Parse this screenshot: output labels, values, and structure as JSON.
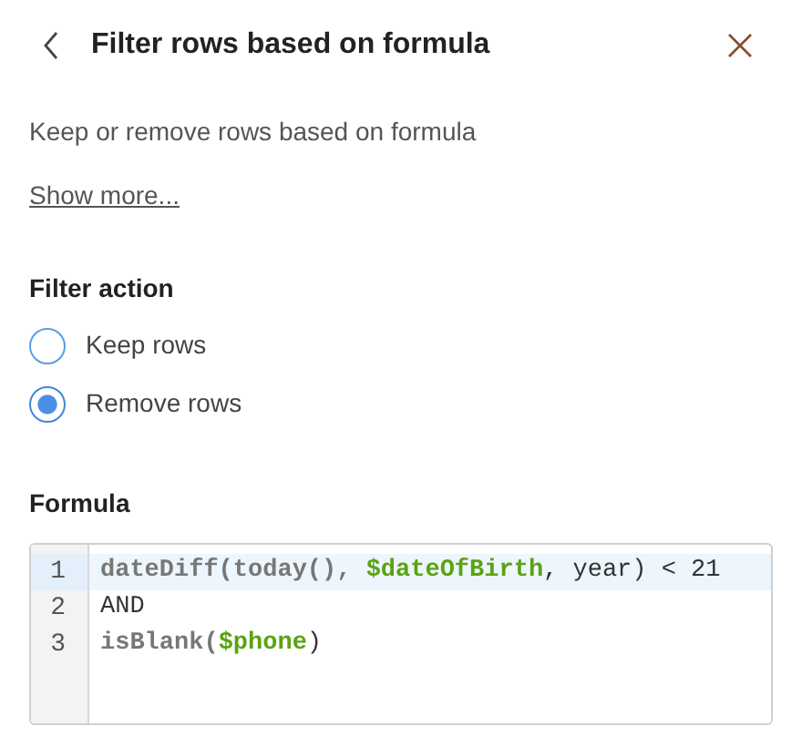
{
  "header": {
    "title": "Filter rows based on formula"
  },
  "description": "Keep or remove rows based on formula",
  "show_more": "Show more...",
  "filter_action": {
    "label": "Filter action",
    "options": [
      {
        "label": "Keep rows",
        "selected": false
      },
      {
        "label": "Remove rows",
        "selected": true
      }
    ]
  },
  "formula": {
    "label": "Formula",
    "lines": [
      {
        "number": "1",
        "active": true,
        "tokens": [
          {
            "kind": "function",
            "text": "dateDiff(today(), "
          },
          {
            "kind": "variable",
            "text": "$dateOfBirth"
          },
          {
            "kind": "plain",
            "text": ", year) < 21"
          }
        ]
      },
      {
        "number": "2",
        "active": false,
        "tokens": [
          {
            "kind": "plain",
            "text": "AND"
          }
        ]
      },
      {
        "number": "3",
        "active": false,
        "tokens": [
          {
            "kind": "function",
            "text": "isBlank("
          },
          {
            "kind": "variable",
            "text": "$phone"
          },
          {
            "kind": "plain",
            "text": ")"
          }
        ]
      }
    ]
  }
}
